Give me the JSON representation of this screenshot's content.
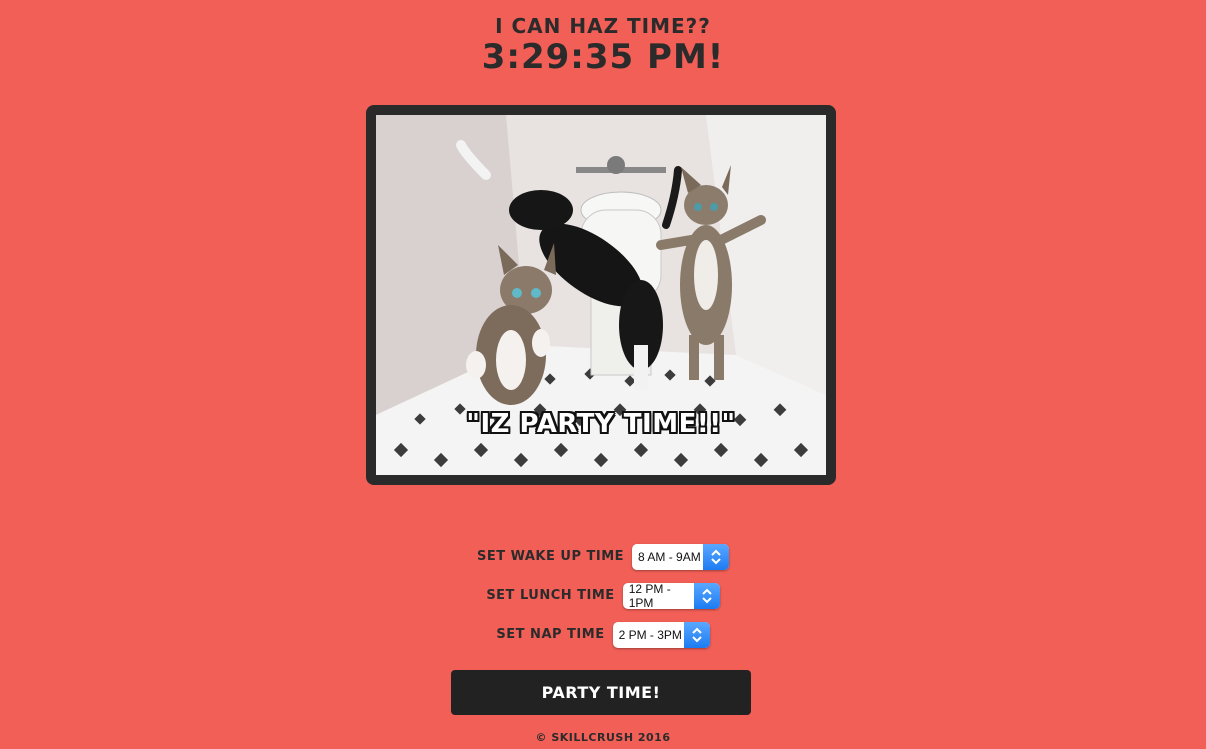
{
  "header": {
    "subtitle": "I CAN HAZ TIME??",
    "clock": "3:29:35 PM!"
  },
  "photo": {
    "caption": "\"IZ PARTY TIME!!\""
  },
  "settings": {
    "wake": {
      "label": "SET WAKE UP TIME",
      "value": "8 AM - 9AM"
    },
    "lunch": {
      "label": "SET LUNCH TIME",
      "value": "12 PM - 1PM"
    },
    "nap": {
      "label": "SET NAP TIME",
      "value": "2 PM - 3PM"
    }
  },
  "party_button": {
    "label": "PARTY TIME!"
  },
  "footer": {
    "text": "© SKILLCRUSH 2016"
  },
  "colors": {
    "background": "#f15f57",
    "dark": "#222222",
    "stepper_blue": "#1d7cf2"
  }
}
